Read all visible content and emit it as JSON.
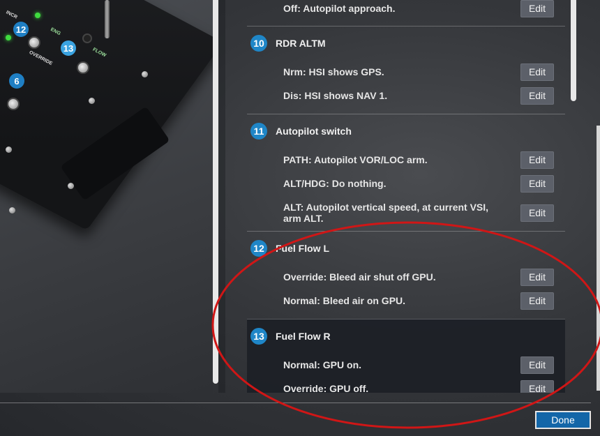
{
  "device_image": {
    "callouts": [
      "12",
      "13",
      "6"
    ],
    "labels": [
      "ENG",
      "FLOW",
      "OVERRIDE",
      "INCR"
    ]
  },
  "sections": [
    {
      "number": "",
      "title": "",
      "rows": [
        {
          "text": "Off: Autopilot approach.",
          "edit": "Edit"
        }
      ]
    },
    {
      "number": "10",
      "title": "RDR ALTM",
      "rows": [
        {
          "text": "Nrm: HSI shows GPS.",
          "edit": "Edit"
        },
        {
          "text": "Dis: HSI shows NAV 1.",
          "edit": "Edit"
        }
      ]
    },
    {
      "number": "11",
      "title": "Autopilot switch",
      "rows": [
        {
          "text": "PATH: Autopilot VOR/LOC arm.",
          "edit": "Edit"
        },
        {
          "text": "ALT/HDG: Do nothing.",
          "edit": "Edit"
        },
        {
          "text": "ALT: Autopilot vertical speed, at current VSI, arm ALT.",
          "edit": "Edit"
        }
      ]
    },
    {
      "number": "12",
      "title": "Fuel Flow L",
      "rows": [
        {
          "text": "Override: Bleed air shut off GPU.",
          "edit": "Edit"
        },
        {
          "text": "Normal: Bleed air on GPU.",
          "edit": "Edit"
        }
      ]
    },
    {
      "number": "13",
      "title": "Fuel Flow R",
      "rows": [
        {
          "text": "Normal: GPU on.",
          "edit": "Edit"
        },
        {
          "text": "Override: GPU off.",
          "edit": "Edit"
        }
      ]
    }
  ],
  "footer": {
    "done_label": "Done"
  },
  "colors": {
    "badge": "#1f86c7",
    "edit_button": "#5c6069",
    "done_button": "#1366a8",
    "annotation_ellipse": "#d01616",
    "highlight_section": "#1c1f26"
  }
}
